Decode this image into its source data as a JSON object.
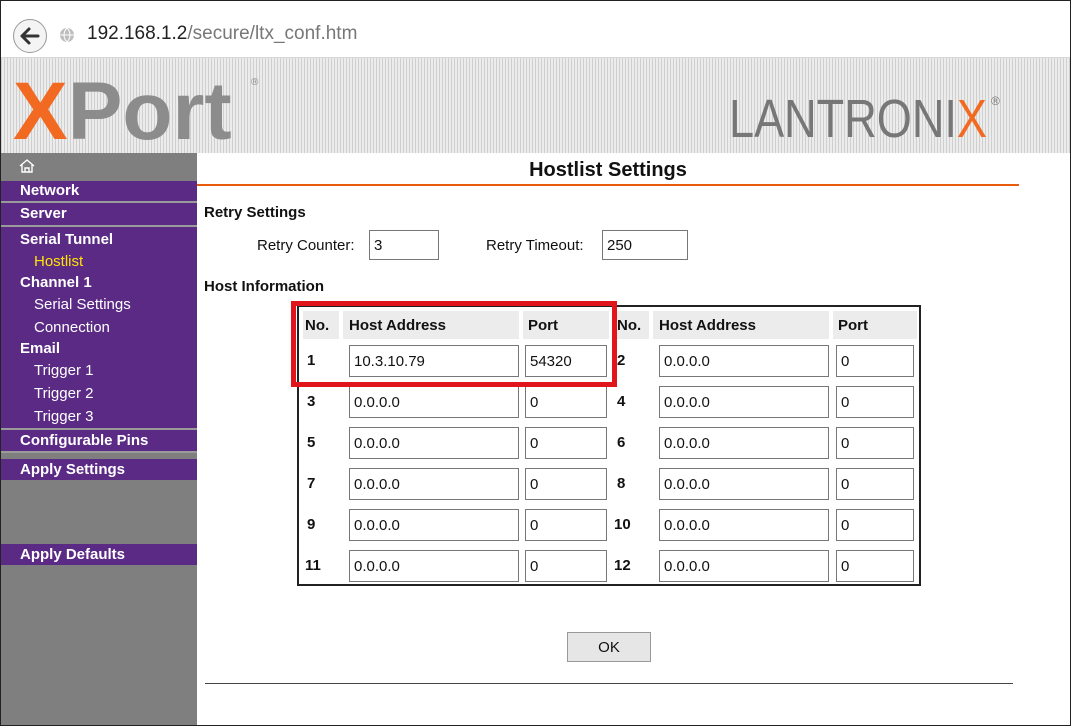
{
  "browser": {
    "url_host": "192.168.1.2",
    "url_path": "/secure/ltx_conf.htm"
  },
  "branding": {
    "product": "XPort",
    "company": "LANTRONIX"
  },
  "sidebar": {
    "network": "Network",
    "server": "Server",
    "serial_tunnel": "Serial Tunnel",
    "hostlist": "Hostlist",
    "channel1": "Channel 1",
    "serial_settings": "Serial Settings",
    "connection": "Connection",
    "email": "Email",
    "trigger1": "Trigger 1",
    "trigger2": "Trigger 2",
    "trigger3": "Trigger 3",
    "configurable_pins": "Configurable Pins",
    "apply_settings": "Apply Settings",
    "apply_defaults": "Apply Defaults"
  },
  "page": {
    "title": "Hostlist Settings",
    "retry_section": "Retry Settings",
    "retry_counter_label": "Retry Counter:",
    "retry_counter_value": "3",
    "retry_timeout_label": "Retry Timeout:",
    "retry_timeout_value": "250",
    "host_section": "Host Information",
    "ok_label": "OK"
  },
  "host_table": {
    "headers": {
      "no": "No.",
      "host_address": "Host Address",
      "port": "Port"
    },
    "hosts": [
      {
        "no": "1",
        "address": "10.3.10.79",
        "port": "54320"
      },
      {
        "no": "2",
        "address": "0.0.0.0",
        "port": "0"
      },
      {
        "no": "3",
        "address": "0.0.0.0",
        "port": "0"
      },
      {
        "no": "4",
        "address": "0.0.0.0",
        "port": "0"
      },
      {
        "no": "5",
        "address": "0.0.0.0",
        "port": "0"
      },
      {
        "no": "6",
        "address": "0.0.0.0",
        "port": "0"
      },
      {
        "no": "7",
        "address": "0.0.0.0",
        "port": "0"
      },
      {
        "no": "8",
        "address": "0.0.0.0",
        "port": "0"
      },
      {
        "no": "9",
        "address": "0.0.0.0",
        "port": "0"
      },
      {
        "no": "10",
        "address": "0.0.0.0",
        "port": "0"
      },
      {
        "no": "11",
        "address": "0.0.0.0",
        "port": "0"
      },
      {
        "no": "12",
        "address": "0.0.0.0",
        "port": "0"
      }
    ]
  },
  "colors": {
    "sidebar_purple": "#5b2a85",
    "accent_orange": "#e85a0c",
    "highlight_red": "#e0161c",
    "active_link": "#ffe300"
  }
}
